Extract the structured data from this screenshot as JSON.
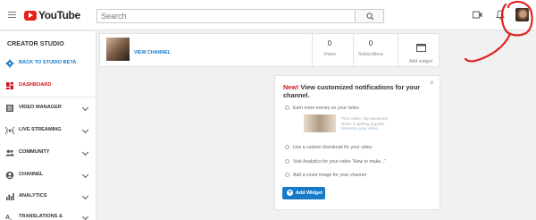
{
  "header": {
    "logo_text": "YouTube",
    "search_placeholder": "Search"
  },
  "sidebar": {
    "title": "CREATOR STUDIO",
    "items": [
      {
        "label": "BACK TO STUDIO BETA",
        "icon": "gear-icon"
      },
      {
        "label": "DASHBOARD",
        "icon": "dashboard-icon"
      },
      {
        "label": "VIDEO MANAGER",
        "icon": "video-manager-icon"
      },
      {
        "label": "LIVE STREAMING",
        "icon": "live-streaming-icon"
      },
      {
        "label": "COMMUNITY",
        "icon": "community-icon"
      },
      {
        "label": "CHANNEL",
        "icon": "channel-icon"
      },
      {
        "label": "ANALYTICS",
        "icon": "analytics-icon"
      },
      {
        "label": "TRANSLATIONS &",
        "icon": "translations-icon"
      }
    ]
  },
  "channel_card": {
    "view_channel": "VIEW CHANNEL",
    "views_count": "0",
    "views_label": "Views",
    "subscribers_count": "0",
    "subscribers_label": "Subscribers",
    "add_widget_label": "Add widget"
  },
  "notification_card": {
    "new_label": "New!",
    "title": "View customized notifications for your channel.",
    "close": "×",
    "items": [
      "Earn more money on your video",
      "Use a custom thumbnail for your video",
      "Visit Analytics for your video \"How to make...\"",
      "Add a cover image for your channel"
    ],
    "preview_line1": "Your video, 'My awesome",
    "preview_line2": "video' is getting popular.",
    "preview_link": "Monetize your video.",
    "button_label": "Add Widget"
  },
  "colors": {
    "brand_red": "#e62117",
    "link_blue": "#167ac6",
    "active_red": "#cc181e",
    "annotation_red": "#e02020"
  }
}
